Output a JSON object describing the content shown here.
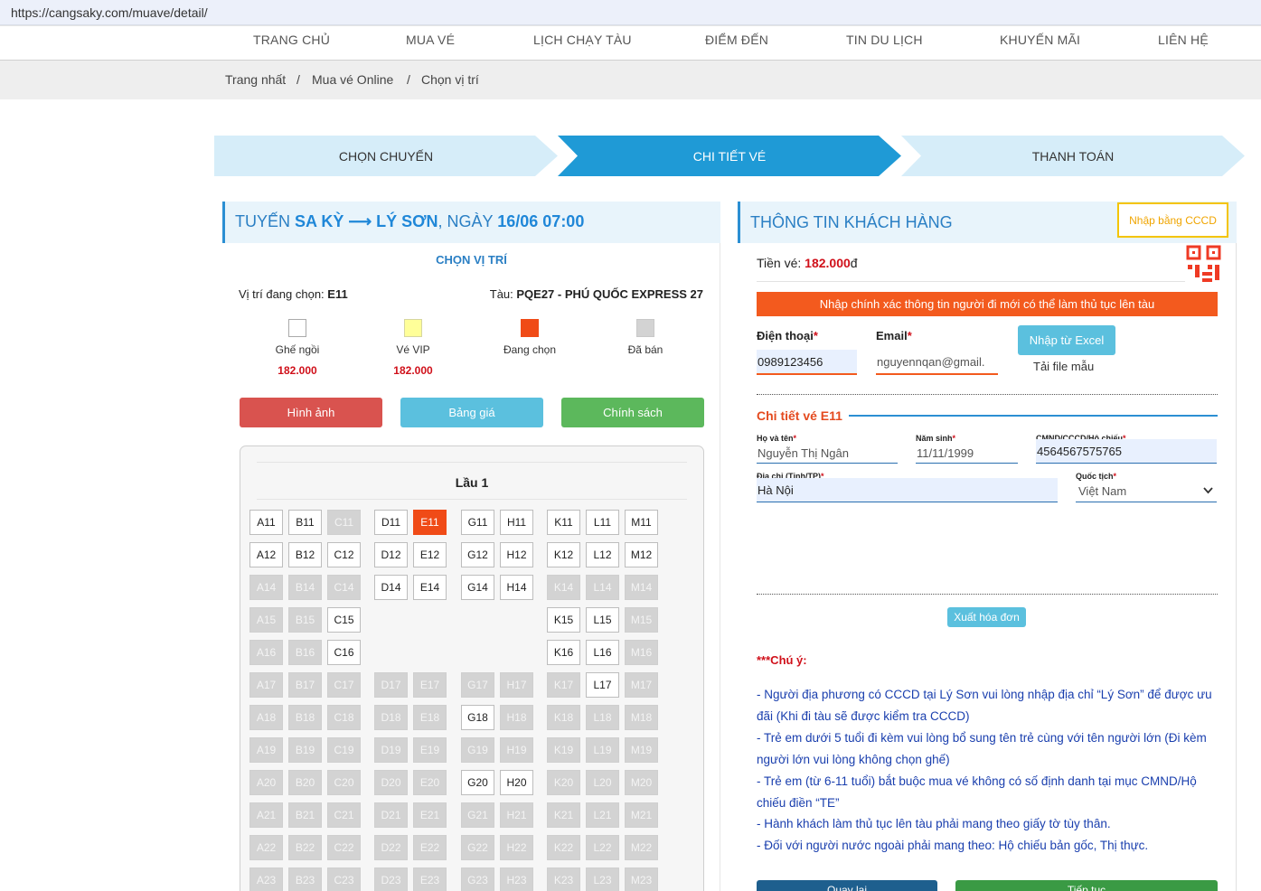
{
  "browser": {
    "url": "https://cangsaky.com/muave/detail/"
  },
  "nav": [
    "TRANG CHỦ",
    "MUA VÉ",
    "LỊCH CHẠY TÀU",
    "ĐIỂM ĐẾN",
    "TIN DU LỊCH",
    "KHUYẾN MÃI",
    "LIÊN HỆ"
  ],
  "breadcrumb": {
    "home": "Trang nhất",
    "sep": "/",
    "buy": "Mua vé Online",
    "current": "Chọn vị trí"
  },
  "steps": [
    "CHỌN CHUYẾN",
    "CHI TIẾT VÉ",
    "THANH TOÁN"
  ],
  "colors": {
    "accent": "#1f9ad6",
    "step_light": "#d6edf9",
    "danger": "#d9534f",
    "info": "#5bc0de",
    "success": "#5cb85c",
    "selected": "#f04b17",
    "warn": "#f35a1e"
  },
  "left": {
    "route_prefix": "TUYẾN ",
    "from": "SA KỲ",
    "arrow": " ⟶ ",
    "to": "LÝ SƠN",
    "date_prefix": ", NGÀY ",
    "date": "16/06 07:00",
    "section_title": "CHỌN VỊ TRÍ",
    "current_label": "Vị trí đang chọn: ",
    "current_seat": "E11",
    "ship_label": "Tàu: ",
    "ship_name": "PQE27 - PHÚ QUỐC EXPRESS 27",
    "legend": [
      {
        "label": "Ghế ngồi",
        "price": "182.000"
      },
      {
        "label": "Vé VIP",
        "price": "182.000"
      },
      {
        "label": "Đang chọn"
      },
      {
        "label": "Đã bán"
      }
    ],
    "buttons": {
      "images": "Hình ảnh",
      "prices": "Bảng giá",
      "policy": "Chính sách"
    },
    "deck": "Lầu 1",
    "seats": [
      {
        "id": "A11",
        "s": "a"
      },
      {
        "id": "B11",
        "s": "a"
      },
      {
        "id": "C11",
        "s": "x"
      },
      {
        "id": "D11",
        "s": "a"
      },
      {
        "id": "E11",
        "s": "c"
      },
      {
        "id": "G11",
        "s": "a"
      },
      {
        "id": "H11",
        "s": "a"
      },
      {
        "id": "K11",
        "s": "a"
      },
      {
        "id": "L11",
        "s": "a"
      },
      {
        "id": "M11",
        "s": "a"
      },
      {
        "id": "A12",
        "s": "a"
      },
      {
        "id": "B12",
        "s": "a"
      },
      {
        "id": "C12",
        "s": "a"
      },
      {
        "id": "D12",
        "s": "a"
      },
      {
        "id": "E12",
        "s": "a"
      },
      {
        "id": "G12",
        "s": "a"
      },
      {
        "id": "H12",
        "s": "a"
      },
      {
        "id": "K12",
        "s": "a"
      },
      {
        "id": "L12",
        "s": "a"
      },
      {
        "id": "M12",
        "s": "a"
      },
      {
        "id": "A14",
        "s": "x"
      },
      {
        "id": "B14",
        "s": "x"
      },
      {
        "id": "C14",
        "s": "x"
      },
      {
        "id": "D14",
        "s": "a"
      },
      {
        "id": "E14",
        "s": "a"
      },
      {
        "id": "G14",
        "s": "a"
      },
      {
        "id": "H14",
        "s": "a"
      },
      {
        "id": "K14",
        "s": "x"
      },
      {
        "id": "L14",
        "s": "x"
      },
      {
        "id": "M14",
        "s": "x"
      },
      {
        "id": "A15",
        "s": "x"
      },
      {
        "id": "B15",
        "s": "x"
      },
      {
        "id": "C15",
        "s": "a"
      },
      {
        "id": "K15",
        "s": "a"
      },
      {
        "id": "L15",
        "s": "a"
      },
      {
        "id": "M15",
        "s": "x"
      },
      {
        "id": "A16",
        "s": "x"
      },
      {
        "id": "B16",
        "s": "x"
      },
      {
        "id": "C16",
        "s": "a"
      },
      {
        "id": "K16",
        "s": "a"
      },
      {
        "id": "L16",
        "s": "a"
      },
      {
        "id": "M16",
        "s": "x"
      },
      {
        "id": "A17",
        "s": "x"
      },
      {
        "id": "B17",
        "s": "x"
      },
      {
        "id": "C17",
        "s": "x"
      },
      {
        "id": "D17",
        "s": "x"
      },
      {
        "id": "E17",
        "s": "x"
      },
      {
        "id": "G17",
        "s": "x"
      },
      {
        "id": "H17",
        "s": "x"
      },
      {
        "id": "K17",
        "s": "x"
      },
      {
        "id": "L17",
        "s": "a"
      },
      {
        "id": "M17",
        "s": "x"
      },
      {
        "id": "A18",
        "s": "x"
      },
      {
        "id": "B18",
        "s": "x"
      },
      {
        "id": "C18",
        "s": "x"
      },
      {
        "id": "D18",
        "s": "x"
      },
      {
        "id": "E18",
        "s": "x"
      },
      {
        "id": "G18",
        "s": "a"
      },
      {
        "id": "H18",
        "s": "x"
      },
      {
        "id": "K18",
        "s": "x"
      },
      {
        "id": "L18",
        "s": "x"
      },
      {
        "id": "M18",
        "s": "x"
      },
      {
        "id": "A19",
        "s": "x"
      },
      {
        "id": "B19",
        "s": "x"
      },
      {
        "id": "C19",
        "s": "x"
      },
      {
        "id": "D19",
        "s": "x"
      },
      {
        "id": "E19",
        "s": "x"
      },
      {
        "id": "G19",
        "s": "x"
      },
      {
        "id": "H19",
        "s": "x"
      },
      {
        "id": "K19",
        "s": "x"
      },
      {
        "id": "L19",
        "s": "x"
      },
      {
        "id": "M19",
        "s": "x"
      },
      {
        "id": "A20",
        "s": "x"
      },
      {
        "id": "B20",
        "s": "x"
      },
      {
        "id": "C20",
        "s": "x"
      },
      {
        "id": "D20",
        "s": "x"
      },
      {
        "id": "E20",
        "s": "x"
      },
      {
        "id": "G20",
        "s": "a"
      },
      {
        "id": "H20",
        "s": "a"
      },
      {
        "id": "K20",
        "s": "x"
      },
      {
        "id": "L20",
        "s": "x"
      },
      {
        "id": "M20",
        "s": "x"
      },
      {
        "id": "A21",
        "s": "x"
      },
      {
        "id": "B21",
        "s": "x"
      },
      {
        "id": "C21",
        "s": "x"
      },
      {
        "id": "D21",
        "s": "x"
      },
      {
        "id": "E21",
        "s": "x"
      },
      {
        "id": "G21",
        "s": "x"
      },
      {
        "id": "H21",
        "s": "x"
      },
      {
        "id": "K21",
        "s": "x"
      },
      {
        "id": "L21",
        "s": "x"
      },
      {
        "id": "M21",
        "s": "x"
      },
      {
        "id": "A22",
        "s": "x"
      },
      {
        "id": "B22",
        "s": "x"
      },
      {
        "id": "C22",
        "s": "x"
      },
      {
        "id": "D22",
        "s": "x"
      },
      {
        "id": "E22",
        "s": "x"
      },
      {
        "id": "G22",
        "s": "x"
      },
      {
        "id": "H22",
        "s": "x"
      },
      {
        "id": "K22",
        "s": "x"
      },
      {
        "id": "L22",
        "s": "x"
      },
      {
        "id": "M22",
        "s": "x"
      },
      {
        "id": "A23",
        "s": "x"
      },
      {
        "id": "B23",
        "s": "x"
      },
      {
        "id": "C23",
        "s": "x"
      },
      {
        "id": "D23",
        "s": "x"
      },
      {
        "id": "E23",
        "s": "x"
      },
      {
        "id": "G23",
        "s": "x"
      },
      {
        "id": "H23",
        "s": "x"
      },
      {
        "id": "K23",
        "s": "x"
      },
      {
        "id": "L23",
        "s": "x"
      },
      {
        "id": "M23",
        "s": "x"
      }
    ]
  },
  "right": {
    "title": "THÔNG TIN KHÁCH HÀNG",
    "cccd_button": "Nhập bằng CCCD",
    "price_label": "Tiền vé: ",
    "price_value": "182.000",
    "price_unit": "đ",
    "warning": "Nhập chính xác thông tin người đi mới có thể làm thủ tục lên tàu",
    "phone_label": "Điện thoại",
    "phone_value": "0989123456",
    "email_label": "Email",
    "email_value": "nguyennqan@gmail.",
    "required": "*",
    "excel_button": "Nhập từ Excel",
    "template_link": "Tải file mẫu",
    "detail_title": "Chi tiết vé E11",
    "name_label": "Họ và tên",
    "name_value": "Nguyễn Thị Ngân",
    "birth_label": "Năm sinh",
    "birth_value": "11/11/1999",
    "id_label": "CMND/CCCD/Hộ chiếu",
    "id_value": "4564567575765",
    "address_label": "Địa chỉ (Tỉnh/TP)",
    "address_value": "Hà Nội",
    "nation_label": "Quốc tịch",
    "nation_value": "Việt Nam",
    "invoice_button": "Xuất hóa đơn",
    "note_title": "***Chú ý:",
    "notes": [
      "- Người địa phương có CCCD tại Lý Sơn vui lòng nhập địa chỉ “Lý Sơn” để được ưu đãi (Khi đi tàu sẽ được kiểm tra CCCD)",
      "- Trẻ em dưới 5 tuổi đi kèm vui lòng bổ sung tên trẻ cùng với tên người lớn (Đi kèm người lớn vui lòng không chọn ghế)",
      "- Trẻ em (từ 6-11 tuổi) bắt buộc mua vé không có số định danh tại mục CMND/Hộ chiếu điền “TE”",
      "- Hành khách làm thủ tục lên tàu phải mang theo giấy tờ tùy thân.",
      "- Đối với người nước ngoài phải mang theo: Hộ chiếu bản gốc, Thị thực."
    ],
    "back_button": "Quay lại",
    "next_button": "Tiếp tục"
  }
}
